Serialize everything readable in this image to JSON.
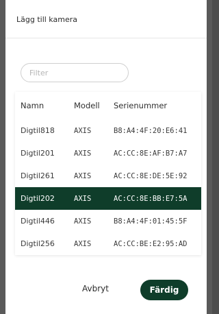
{
  "dialog": {
    "title": "Lägg till kamera"
  },
  "filter": {
    "placeholder": "Filter",
    "value": ""
  },
  "table": {
    "columns": [
      "Namn",
      "Modell",
      "Serienummer"
    ],
    "rows": [
      {
        "name": "Digtil818",
        "model": "AXIS",
        "serial": "B8:A4:4F:20:E6:41",
        "selected": false
      },
      {
        "name": "Digtil201",
        "model": "AXIS",
        "serial": "AC:CC:8E:AF:B7:A7",
        "selected": false
      },
      {
        "name": "Digtil261",
        "model": "AXIS",
        "serial": "AC:CC:8E:DE:5E:92",
        "selected": false
      },
      {
        "name": "Digtil202",
        "model": "AXIS",
        "serial": "AC:CC:8E:BB:E7:5A",
        "selected": true
      },
      {
        "name": "Digtil446",
        "model": "AXIS",
        "serial": "B8:A4:4F:01:45:5F",
        "selected": false
      },
      {
        "name": "Digtil256",
        "model": "AXIS",
        "serial": "AC:CC:BE:E2:95:AD",
        "selected": false
      }
    ]
  },
  "actions": {
    "cancel_label": "Avbryt",
    "done_label": "Färdig"
  },
  "colors": {
    "accent": "#0f3d2a",
    "overlay": "#5a5a5a"
  }
}
